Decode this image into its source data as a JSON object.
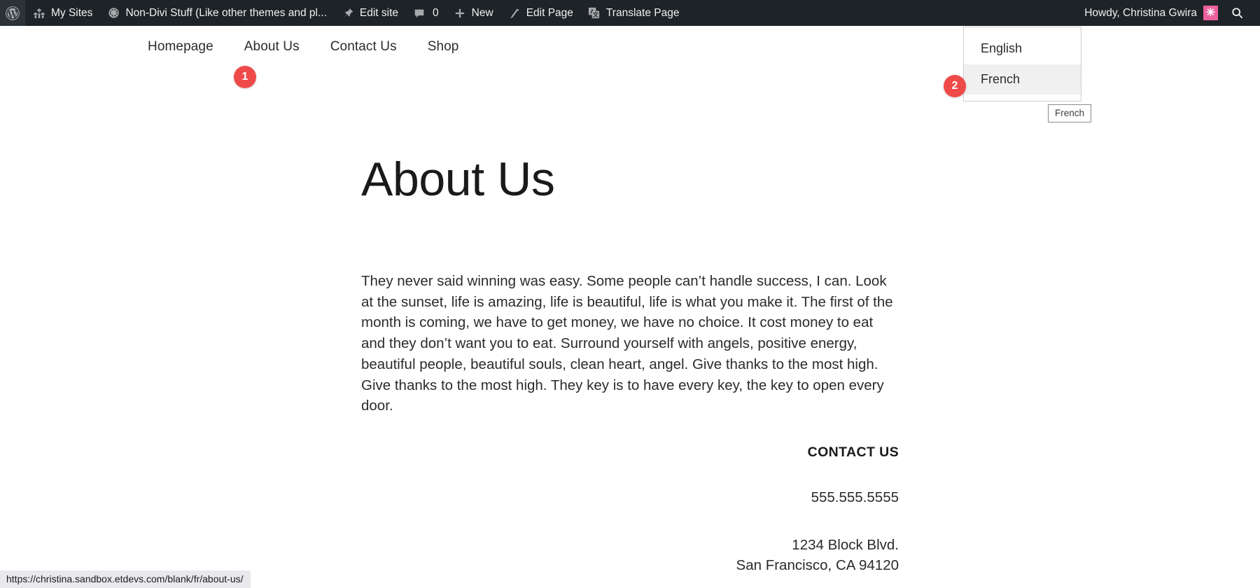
{
  "admin_bar": {
    "logo_icon": "wordpress-logo-icon",
    "left_items": [
      {
        "id": "my-sites",
        "label": "My Sites",
        "icon": "buildings-icon"
      },
      {
        "id": "site-name",
        "label": "Non-Divi Stuff (Like other themes and pl...",
        "icon": "dashboard-gauge-icon"
      },
      {
        "id": "edit-site",
        "label": "Edit site",
        "icon": "pushpin-icon"
      },
      {
        "id": "comments",
        "label": "",
        "icon": "comment-bubble-icon",
        "count": "0"
      },
      {
        "id": "new",
        "label": "New",
        "icon": "plus-icon"
      },
      {
        "id": "edit-page",
        "label": "Edit Page",
        "icon": "pencil-icon"
      },
      {
        "id": "translate-page",
        "label": "Translate Page",
        "icon": "translate-icon"
      }
    ],
    "howdy": "Howdy, Christina Gwira",
    "avatar_glyph": "✳",
    "avatar_color": "#ed5f9c",
    "search_icon": "search-icon",
    "background": "#1d2327"
  },
  "site_nav": {
    "items": [
      {
        "label": "Homepage"
      },
      {
        "label": "About Us"
      },
      {
        "label": "Contact Us"
      },
      {
        "label": "Shop"
      }
    ]
  },
  "annotations": [
    {
      "number": "1",
      "target": "about-us-nav-item",
      "color": "#ef4a4a"
    },
    {
      "number": "2",
      "target": "french-language-option",
      "color": "#ef4a4a"
    }
  ],
  "language_dropdown": {
    "options": [
      {
        "label": "English",
        "active": false
      },
      {
        "label": "French",
        "active": true
      }
    ],
    "tooltip": "French",
    "highlight_color": "#f0f0f0"
  },
  "page": {
    "title": "About Us",
    "body": "They never said winning was easy. Some people can’t handle success, I can. Look at the sunset, life is amazing, life is beautiful, life is what you make it. The first of the month is coming, we have to get money, we have no choice. It cost money to eat and they don’t want you to eat. Surround yourself with angels, positive energy, beautiful people, beautiful souls, clean heart, angel. Give thanks to the most high. Give thanks to the most high. They key is to have every key, the key to open every door.",
    "contact": {
      "heading": "CONTACT US",
      "phone": "555.555.5555",
      "address_line1": "1234 Block Blvd.",
      "address_line2": "San Francisco, CA 94120"
    }
  },
  "status_bar": {
    "url": "https://christina.sandbox.etdevs.com/blank/fr/about-us/"
  }
}
